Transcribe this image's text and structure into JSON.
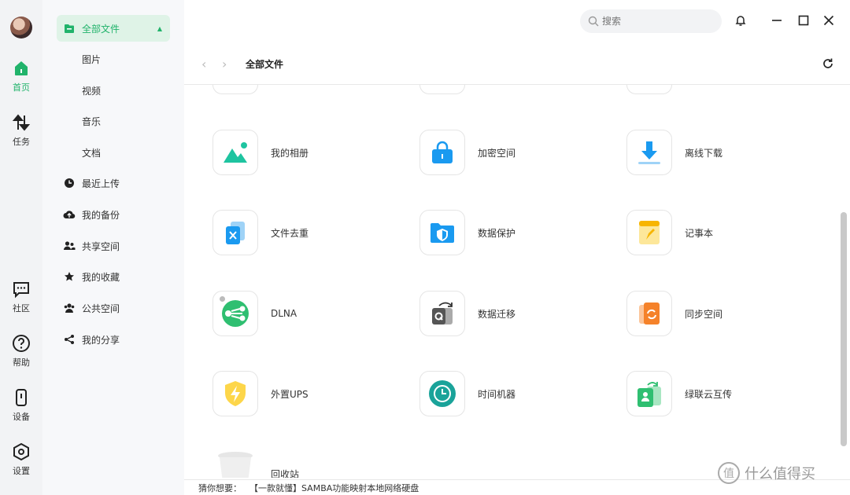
{
  "rail": {
    "items": [
      {
        "label": "首页",
        "icon": "home-icon"
      },
      {
        "label": "任务",
        "icon": "transfer-icon"
      },
      {
        "label": "社区",
        "icon": "chat-icon"
      },
      {
        "label": "帮助",
        "icon": "help-icon"
      },
      {
        "label": "设备",
        "icon": "device-icon"
      },
      {
        "label": "设置",
        "icon": "settings-icon"
      }
    ]
  },
  "sidebar": {
    "all_files": "全部文件",
    "subs": [
      "图片",
      "视频",
      "音乐",
      "文档"
    ],
    "items": [
      {
        "label": "最近上传",
        "icon": "clock-icon"
      },
      {
        "label": "我的备份",
        "icon": "cloud-upload-icon"
      },
      {
        "label": "共享空间",
        "icon": "users-icon"
      },
      {
        "label": "我的收藏",
        "icon": "star-icon"
      },
      {
        "label": "公共空间",
        "icon": "group-icon"
      },
      {
        "label": "我的分享",
        "icon": "share-icon"
      }
    ]
  },
  "search": {
    "placeholder": "搜索"
  },
  "breadcrumb": {
    "title": "全部文件"
  },
  "tiles": [
    {
      "label": "我的相册",
      "icon": "album-icon"
    },
    {
      "label": "加密空间",
      "icon": "lock-icon"
    },
    {
      "label": "离线下载",
      "icon": "download-icon"
    },
    {
      "label": "文件去重",
      "icon": "dedupe-icon"
    },
    {
      "label": "数据保护",
      "icon": "shield-folder-icon"
    },
    {
      "label": "记事本",
      "icon": "notepad-icon"
    },
    {
      "label": "DLNA",
      "icon": "dlna-icon"
    },
    {
      "label": "数据迁移",
      "icon": "migrate-icon"
    },
    {
      "label": "同步空间",
      "icon": "sync-icon"
    },
    {
      "label": "外置UPS",
      "icon": "ups-icon"
    },
    {
      "label": "时间机器",
      "icon": "time-machine-icon"
    },
    {
      "label": "绿联云互传",
      "icon": "transfer-phone-icon"
    },
    {
      "label": "回收站",
      "icon": "trash-icon"
    }
  ],
  "footer": {
    "prefix": "猜你想要：",
    "link": "【一款就懂】SAMBA功能映射本地网络硬盘"
  },
  "watermark": {
    "text": "什么值得买",
    "mark": "值"
  },
  "colors": {
    "accent": "#21b36b",
    "blue": "#1a9af0",
    "orange": "#f5822a",
    "teal": "#1aa39a"
  }
}
